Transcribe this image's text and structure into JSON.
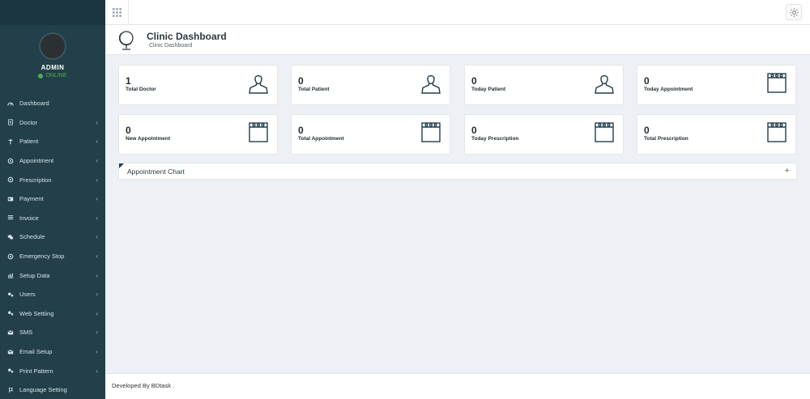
{
  "sidebar": {
    "profile": {
      "name": "ADMIN",
      "status": "ONLINE"
    },
    "items": [
      {
        "label": "Dashboard",
        "icon": "dashboard-icon",
        "chevron": ""
      },
      {
        "label": "Doctor",
        "icon": "doctor-icon",
        "chevron": "‹"
      },
      {
        "label": "Patient",
        "icon": "patient-icon",
        "chevron": "‹"
      },
      {
        "label": "Appointment",
        "icon": "appointment-icon",
        "chevron": "‹"
      },
      {
        "label": "Prescription",
        "icon": "prescription-icon",
        "chevron": "‹"
      },
      {
        "label": "Payment",
        "icon": "payment-icon",
        "chevron": "‹"
      },
      {
        "label": "Invoice",
        "icon": "invoice-icon",
        "chevron": "‹"
      },
      {
        "label": "Schedule",
        "icon": "schedule-icon",
        "chevron": "‹"
      },
      {
        "label": "Emergency Stop",
        "icon": "emergency-stop-icon",
        "chevron": "‹"
      },
      {
        "label": "Setup Data",
        "icon": "setup-data-icon",
        "chevron": "‹"
      },
      {
        "label": "Users",
        "icon": "users-icon",
        "chevron": "‹"
      },
      {
        "label": "Web Settiing",
        "icon": "web-setting-icon",
        "chevron": "‹"
      },
      {
        "label": "SMS",
        "icon": "sms-icon",
        "chevron": "‹"
      },
      {
        "label": "Email Setup",
        "icon": "email-setup-icon",
        "chevron": "‹"
      },
      {
        "label": "Print Pattern",
        "icon": "print-pattern-icon",
        "chevron": "‹"
      },
      {
        "label": "Language Setting",
        "icon": "language-setting-icon",
        "chevron": ""
      }
    ]
  },
  "header": {
    "title": "Clinic Dashboard",
    "breadcrumb": "Clinic Dashboard"
  },
  "cards": [
    {
      "value": "1",
      "label": "Total Doctor",
      "icon": "user-icon"
    },
    {
      "value": "0",
      "label": "Total Patient",
      "icon": "user-icon"
    },
    {
      "value": "0",
      "label": "Today Patient",
      "icon": "user-icon"
    },
    {
      "value": "0",
      "label": "Today Appointment",
      "icon": "calendar-icon"
    },
    {
      "value": "0",
      "label": "New Appointment",
      "icon": "calendar-icon"
    },
    {
      "value": "0",
      "label": "Total Appointment",
      "icon": "calendar-icon"
    },
    {
      "value": "0",
      "label": "Today Prescription",
      "icon": "calendar-icon"
    },
    {
      "value": "0",
      "label": "Total Prescription",
      "icon": "calendar-icon"
    }
  ],
  "panel": {
    "title": "Appointment Chart",
    "toggle": "+"
  },
  "footer": {
    "text": "Developed By BDtask ."
  },
  "colors": {
    "sidebar": "#223f4a",
    "online": "#4caf50",
    "background": "#edf0f4"
  }
}
